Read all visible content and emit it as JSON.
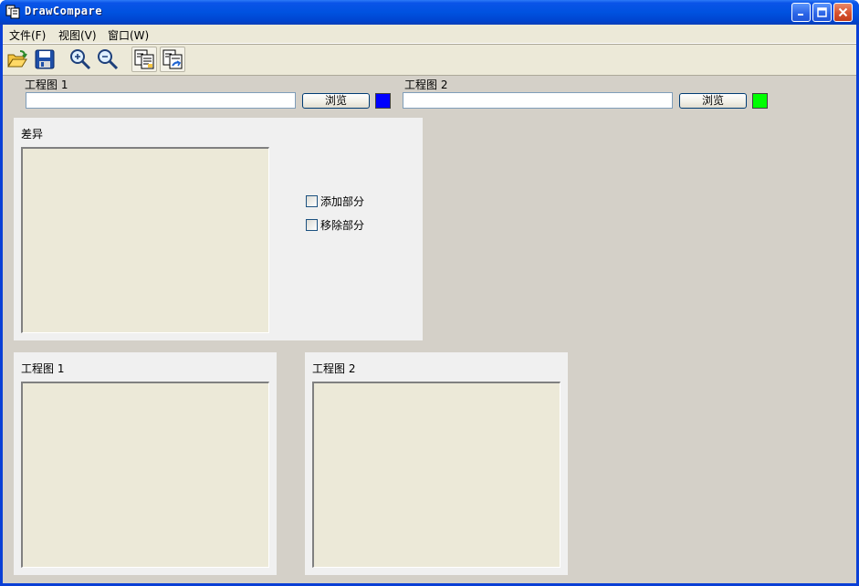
{
  "window": {
    "title": "DrawCompare"
  },
  "menu": [
    {
      "label": "文件(F)"
    },
    {
      "label": "视图(V)"
    },
    {
      "label": "窗口(W)"
    }
  ],
  "toolbar": {
    "buttons": [
      {
        "name": "open-folder-icon"
      },
      {
        "name": "save-disk-icon"
      },
      {
        "name": "zoom-in-icon"
      },
      {
        "name": "zoom-out-icon"
      },
      {
        "name": "compare-drawing-icon"
      },
      {
        "name": "compare-refresh-icon"
      }
    ]
  },
  "drawing1": {
    "label": "工程图 1",
    "path_value": "",
    "browse_label": "浏览",
    "color": "#0000ff"
  },
  "drawing2": {
    "label": "工程图 2",
    "path_value": "",
    "browse_label": "浏览",
    "color": "#00ff00"
  },
  "diff_panel": {
    "title": "差异",
    "options": [
      {
        "label": "添加部分",
        "checked": false
      },
      {
        "label": "移除部分",
        "checked": false
      }
    ]
  },
  "view1_panel": {
    "title": "工程图 1"
  },
  "view2_panel": {
    "title": "工程图 2"
  },
  "colors": {
    "titlebar": "#0054e3",
    "client": "#d4d0c8",
    "panel": "#f0f0f0"
  }
}
